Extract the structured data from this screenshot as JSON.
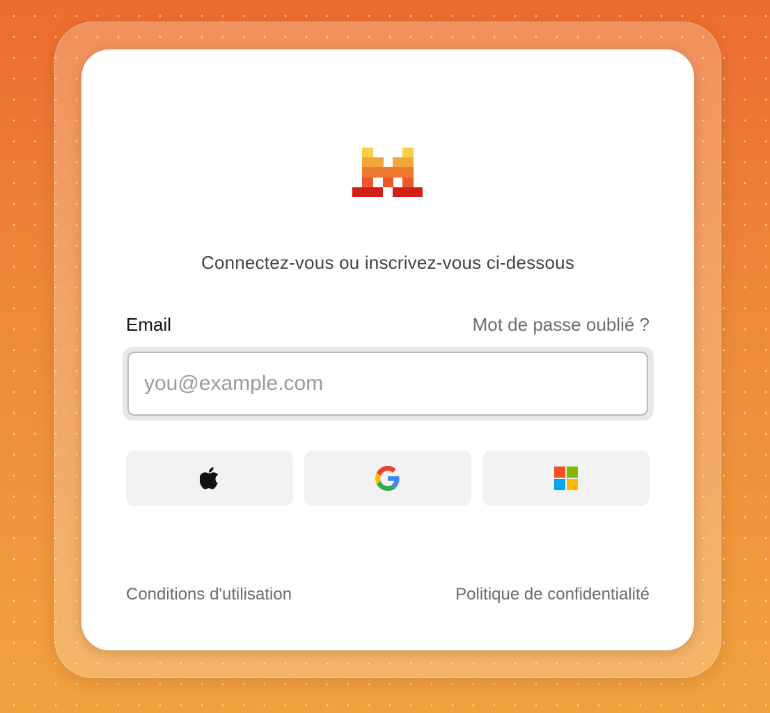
{
  "auth": {
    "subtitle": "Connectez-vous ou inscrivez-vous ci-dessous",
    "email_label": "Email",
    "forgot_password": "Mot de passe oublié ?",
    "email_placeholder": "you@example.com",
    "email_value": ""
  },
  "sso": [
    {
      "provider": "apple",
      "icon": "apple-icon"
    },
    {
      "provider": "google",
      "icon": "google-icon"
    },
    {
      "provider": "microsoft",
      "icon": "microsoft-icon"
    }
  ],
  "footer": {
    "terms": "Conditions d'utilisation",
    "privacy": "Politique de confidentialité"
  },
  "colors": {
    "background_top": "#ec6c2f",
    "background_bottom": "#f1a23f",
    "logo_yellow": "#f7d046",
    "logo_orange": "#f2a73b",
    "logo_dark_orange": "#ee792f",
    "logo_red_orange": "#eb5829",
    "logo_red": "#d11e16"
  }
}
